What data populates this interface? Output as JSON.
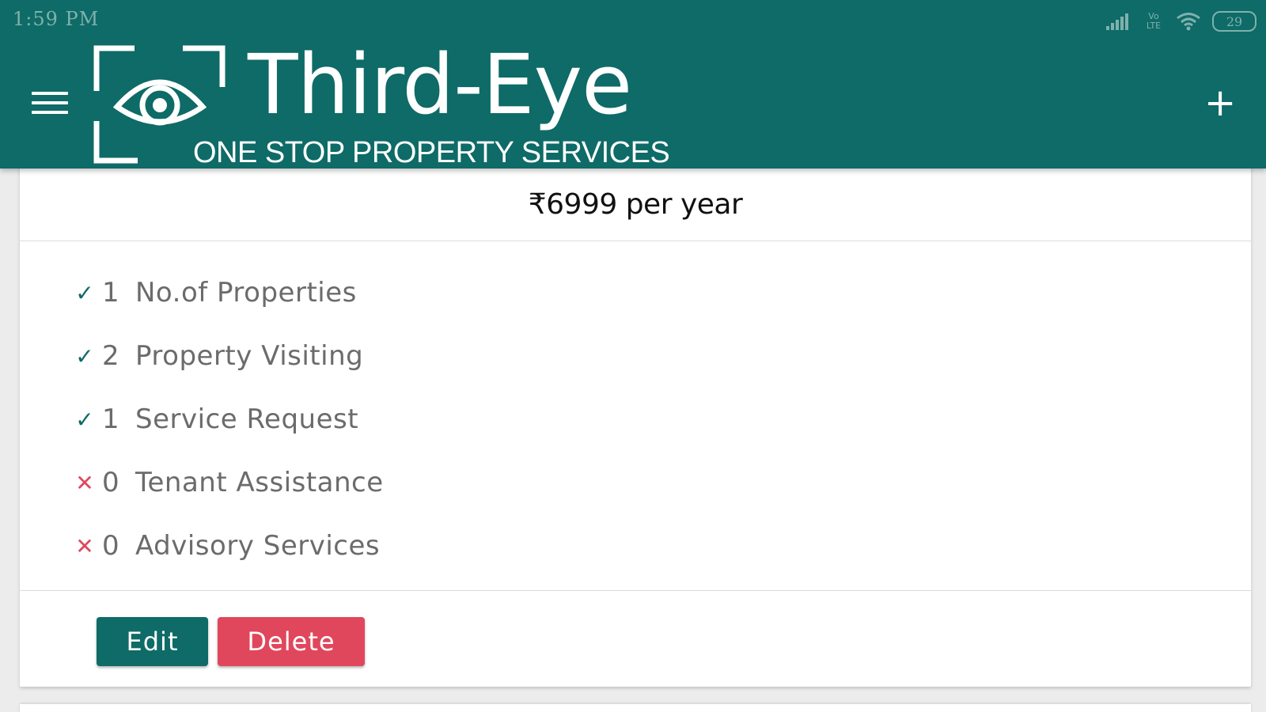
{
  "status_bar": {
    "time": "1:59 PM",
    "network_label": "Vo LTE",
    "battery": "29"
  },
  "header": {
    "brand": "Third-Eye",
    "tagline": "ONE STOP PROPERTY SERVICES",
    "color": "#0e6b67"
  },
  "plan": {
    "price": "₹6999 per year",
    "features": [
      {
        "included": true,
        "mark": "✓",
        "count": "1",
        "label": "No.of Properties"
      },
      {
        "included": true,
        "mark": "✓",
        "count": "2",
        "label": "Property Visiting"
      },
      {
        "included": true,
        "mark": "✓",
        "count": "1",
        "label": "Service Request"
      },
      {
        "included": false,
        "mark": "✕",
        "count": "0",
        "label": "Tenant Assistance"
      },
      {
        "included": false,
        "mark": "✕",
        "count": "0",
        "label": "Advisory Services"
      }
    ],
    "edit_label": "Edit",
    "delete_label": "Delete",
    "edit_color": "#0e6b67",
    "delete_color": "#e0475c"
  }
}
